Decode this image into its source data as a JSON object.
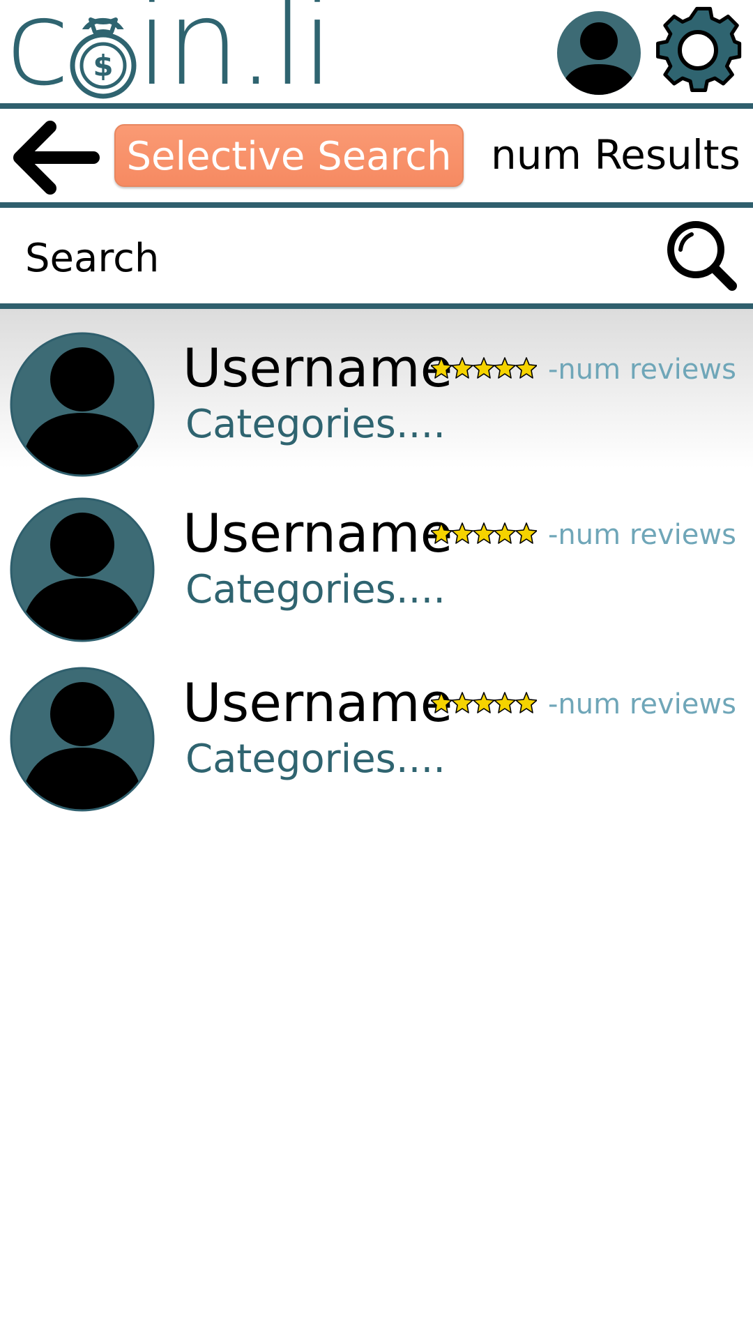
{
  "header": {
    "logo_text": "coin.li",
    "logo_dollar": "$",
    "colors": {
      "brand": "#2f6470",
      "divider": "#2f5f6d",
      "avatar_bg": "#3d6b75"
    }
  },
  "toolbar": {
    "back_icon": "arrow-left-icon",
    "selective_search_label": "Selective Search",
    "results_label": "num Results",
    "colors": {
      "selective_search_bg": "#f68a62"
    }
  },
  "search": {
    "placeholder": "Search",
    "icon": "search-icon"
  },
  "results": [
    {
      "username": "Username",
      "rating": 5,
      "reviews": "-num reviews",
      "categories": "Categories...."
    },
    {
      "username": "Username",
      "rating": 5,
      "reviews": "-num reviews",
      "categories": "Categories...."
    },
    {
      "username": "Username",
      "rating": 5,
      "reviews": "-num reviews",
      "categories": "Categories...."
    }
  ],
  "colors": {
    "star": "#f5d300",
    "reviews_text": "#6fa6b8",
    "categories_text": "#2f6470"
  }
}
